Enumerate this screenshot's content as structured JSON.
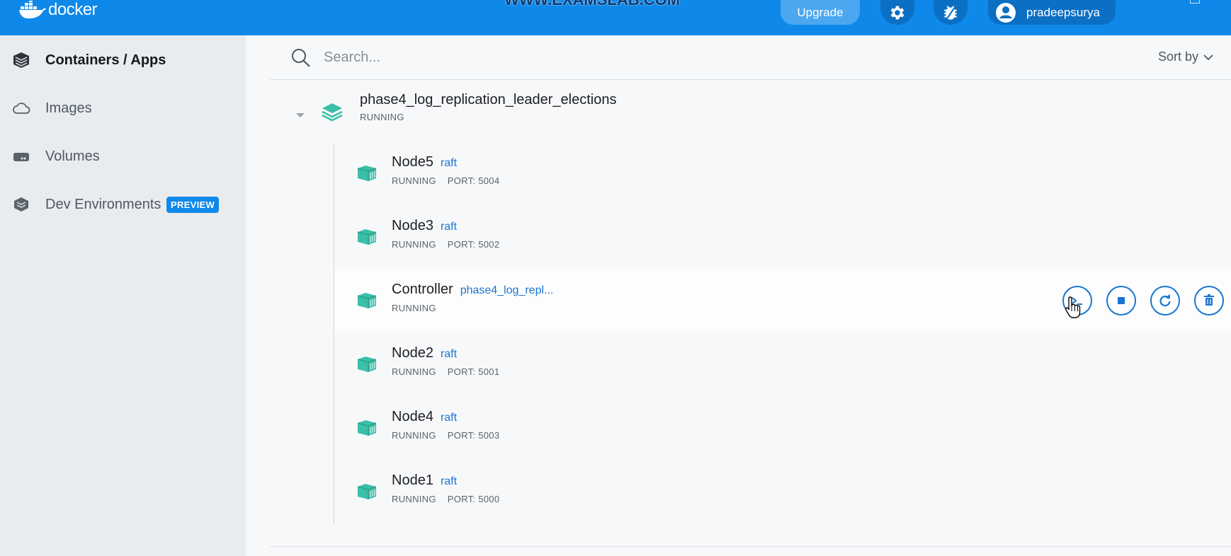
{
  "header": {
    "logo_text": "docker",
    "watermark_text": "WWW.EXAMSLAB.COM",
    "upgrade_label": "Upgrade",
    "username": "pradeepsurya",
    "icons": [
      "settings-icon",
      "bug-icon",
      "account-icon"
    ],
    "bar_color": "#0e89ea"
  },
  "sidebar": {
    "items": [
      {
        "label": "Containers / Apps",
        "icon": "containers-icon",
        "active": true
      },
      {
        "label": "Images",
        "icon": "cloud-icon",
        "active": false
      },
      {
        "label": "Volumes",
        "icon": "volume-icon",
        "active": false
      },
      {
        "label": "Dev Environments",
        "icon": "dev-env-icon",
        "active": false,
        "badge": "PREVIEW"
      }
    ]
  },
  "search": {
    "placeholder": "Search...",
    "sort_label": "Sort by"
  },
  "app": {
    "name": "phase4_log_replication_leader_elections",
    "status": "RUNNING"
  },
  "containers": [
    {
      "name": "Node5",
      "image": "raft",
      "status": "RUNNING",
      "port": "PORT: 5004"
    },
    {
      "name": "Node3",
      "image": "raft",
      "status": "RUNNING",
      "port": "PORT: 5002"
    },
    {
      "name": "Controller",
      "image": "phase4_log_repl...",
      "status": "RUNNING",
      "port": ""
    },
    {
      "name": "Node2",
      "image": "raft",
      "status": "RUNNING",
      "port": "PORT: 5001"
    },
    {
      "name": "Node4",
      "image": "raft",
      "status": "RUNNING",
      "port": "PORT: 5003"
    },
    {
      "name": "Node1",
      "image": "raft",
      "status": "RUNNING",
      "port": "PORT: 5000"
    }
  ],
  "row_actions": [
    "cli-icon",
    "stop-icon",
    "restart-icon",
    "delete-icon"
  ],
  "colors": {
    "accent": "#1976d2",
    "container_icon": "#3bbfa8"
  }
}
